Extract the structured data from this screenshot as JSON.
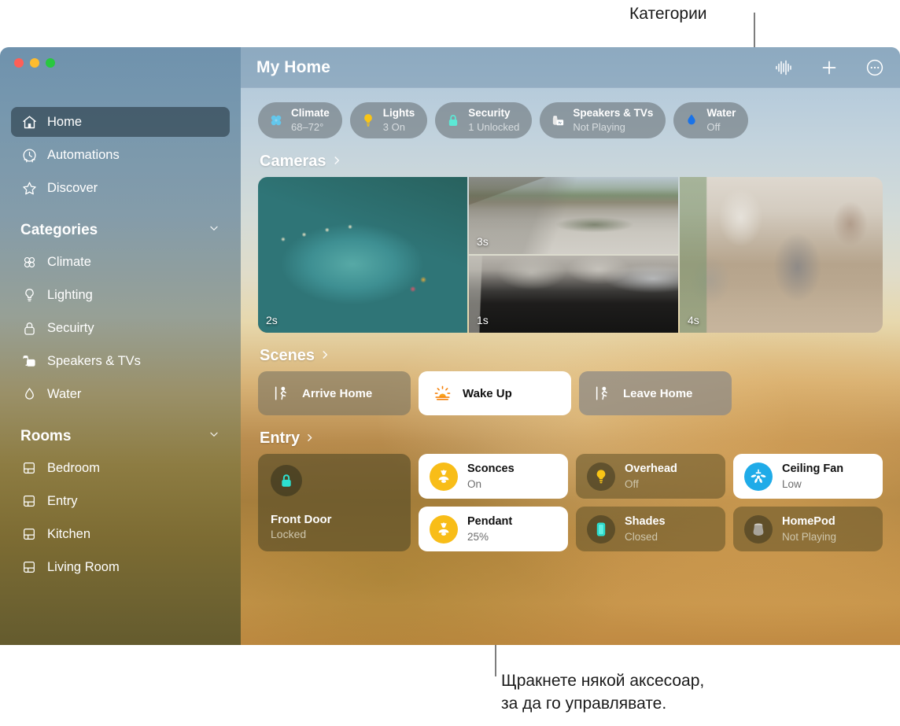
{
  "annotations": {
    "top": "Категории",
    "bottom_line1": "Щракнете някой аксесоар,",
    "bottom_line2": "за да го управлявате."
  },
  "window": {
    "traffic_lights": [
      "close",
      "minimize",
      "zoom"
    ]
  },
  "sidebar": {
    "primary": [
      {
        "label": "Home",
        "icon": "house-icon",
        "selected": true
      },
      {
        "label": "Automations",
        "icon": "clock-icon",
        "selected": false
      },
      {
        "label": "Discover",
        "icon": "star-icon",
        "selected": false
      }
    ],
    "categories_header": "Categories",
    "categories": [
      {
        "label": "Climate",
        "icon": "fan-icon"
      },
      {
        "label": "Lighting",
        "icon": "bulb-icon"
      },
      {
        "label": "Secuirty",
        "icon": "lock-icon"
      },
      {
        "label": "Speakers & TVs",
        "icon": "speaker-tv-icon"
      },
      {
        "label": "Water",
        "icon": "droplet-icon"
      }
    ],
    "rooms_header": "Rooms",
    "rooms": [
      {
        "label": "Bedroom",
        "icon": "room-icon"
      },
      {
        "label": "Entry",
        "icon": "room-icon"
      },
      {
        "label": "Kitchen",
        "icon": "room-icon"
      },
      {
        "label": "Living Room",
        "icon": "room-icon"
      }
    ]
  },
  "header": {
    "title": "My Home",
    "actions": [
      {
        "name": "siri-waveform-icon"
      },
      {
        "name": "add-icon"
      },
      {
        "name": "more-options-icon"
      }
    ]
  },
  "status_chips": [
    {
      "label": "Climate",
      "value": "68–72°",
      "icon": "fan-icon",
      "color": "#63c7ec"
    },
    {
      "label": "Lights",
      "value": "3 On",
      "icon": "bulb-icon",
      "color": "#f9c516"
    },
    {
      "label": "Security",
      "value": "1 Unlocked",
      "icon": "lock-icon",
      "color": "#5ce8d5"
    },
    {
      "label": "Speakers & TVs",
      "value": "Not Playing",
      "icon": "speaker-tv-icon",
      "color": "#e8e8e8"
    },
    {
      "label": "Water",
      "value": "Off",
      "icon": "droplet-icon",
      "color": "#1a73e8"
    }
  ],
  "sections": {
    "cameras_title": "Cameras",
    "scenes_title": "Scenes",
    "entry_title": "Entry"
  },
  "cameras": [
    {
      "name": "pool-camera",
      "timestamp": "2s"
    },
    {
      "name": "driveway-camera",
      "timestamp": "3s"
    },
    {
      "name": "garage-camera",
      "timestamp": "1s"
    },
    {
      "name": "living-room-camera",
      "timestamp": "4s"
    }
  ],
  "scenes": [
    {
      "label": "Arrive Home",
      "icon": "walk-in-icon",
      "active": false,
      "style": "warm"
    },
    {
      "label": "Wake Up",
      "icon": "sunrise-icon",
      "active": true,
      "style": "white"
    },
    {
      "label": "Leave Home",
      "icon": "walk-out-icon",
      "active": false,
      "style": "grey"
    }
  ],
  "entry_accessories": {
    "door": {
      "label": "Front Door",
      "state": "Locked",
      "icon": "lock-icon",
      "color": "#2de0d0"
    },
    "tiles": [
      {
        "label": "Sconces",
        "state": "On",
        "icon": "sconce-icon",
        "on": true,
        "swatch": "yellow"
      },
      {
        "label": "Pendant",
        "state": "25%",
        "icon": "pendant-icon",
        "on": true,
        "swatch": "yellow"
      },
      {
        "label": "Overhead",
        "state": "Off",
        "icon": "bulb-icon",
        "on": false,
        "swatch": "dark"
      },
      {
        "label": "Shades",
        "state": "Closed",
        "icon": "shade-icon",
        "on": false,
        "swatch": "dark"
      },
      {
        "label": "Ceiling Fan",
        "state": "Low",
        "icon": "ceiling-fan-icon",
        "on": true,
        "swatch": "blue"
      },
      {
        "label": "HomePod",
        "state": "Not Playing",
        "icon": "homepod-icon",
        "on": false,
        "swatch": "dark"
      }
    ]
  }
}
